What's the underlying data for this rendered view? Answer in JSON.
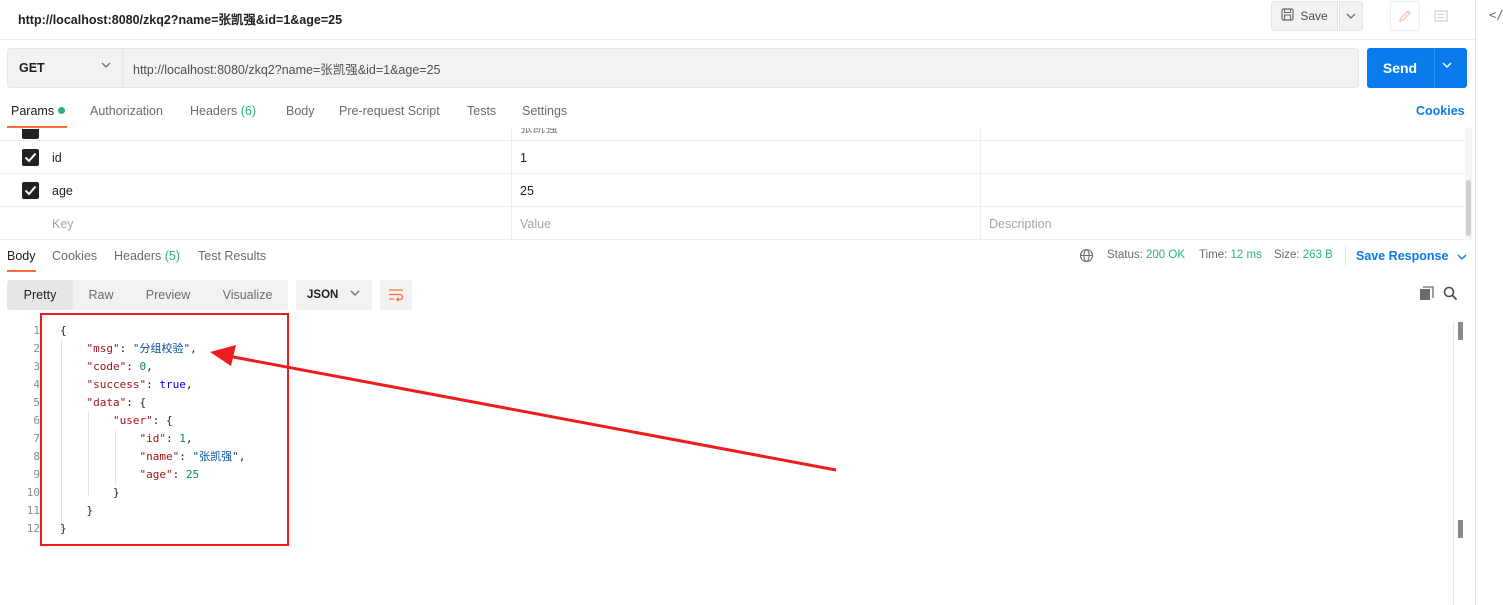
{
  "request": {
    "title": "http://localhost:8080/zkq2?name=张凯强&id=1&age=25",
    "save_label": "Save",
    "method": "GET",
    "url": "http://localhost:8080/zkq2?name=张凯强&id=1&age=25",
    "send_label": "Send"
  },
  "request_tabs": {
    "params": "Params",
    "authorization": "Authorization",
    "headers": "Headers",
    "headers_count": "(6)",
    "body": "Body",
    "prerequest": "Pre-request Script",
    "tests": "Tests",
    "settings": "Settings",
    "cookies": "Cookies"
  },
  "params": {
    "partial_value": "张凯强",
    "rows": [
      {
        "key": "id",
        "value": "1",
        "checked": true
      },
      {
        "key": "age",
        "value": "25",
        "checked": true
      }
    ],
    "placeholder_key": "Key",
    "placeholder_value": "Value",
    "placeholder_description": "Description"
  },
  "response_tabs": {
    "body": "Body",
    "cookies": "Cookies",
    "headers": "Headers",
    "headers_count": "(5)",
    "test_results": "Test Results"
  },
  "response_meta": {
    "status_label": "Status:",
    "status_value": "200 OK",
    "time_label": "Time:",
    "time_value": "12 ms",
    "size_label": "Size:",
    "size_value": "263 B",
    "save_response": "Save Response"
  },
  "body_view": {
    "pretty": "Pretty",
    "raw": "Raw",
    "preview": "Preview",
    "visualize": "Visualize",
    "format": "JSON"
  },
  "json_lines": [
    {
      "n": "1",
      "parts": [
        [
          "p",
          "{"
        ]
      ]
    },
    {
      "n": "2",
      "parts": [
        [
          "k",
          "    \"msg\""
        ],
        [
          "p",
          ": "
        ],
        [
          "s",
          "\"分组校验\""
        ],
        [
          "p",
          ","
        ]
      ]
    },
    {
      "n": "3",
      "parts": [
        [
          "k",
          "    \"code\""
        ],
        [
          "p",
          ": "
        ],
        [
          "n",
          "0"
        ],
        [
          "p",
          ","
        ]
      ]
    },
    {
      "n": "4",
      "parts": [
        [
          "k",
          "    \"success\""
        ],
        [
          "p",
          ": "
        ],
        [
          "b",
          "true"
        ],
        [
          "p",
          ","
        ]
      ]
    },
    {
      "n": "5",
      "parts": [
        [
          "k",
          "    \"data\""
        ],
        [
          "p",
          ": {"
        ]
      ]
    },
    {
      "n": "6",
      "parts": [
        [
          "k",
          "        \"user\""
        ],
        [
          "p",
          ": {"
        ]
      ]
    },
    {
      "n": "7",
      "parts": [
        [
          "k",
          "            \"id\""
        ],
        [
          "p",
          ": "
        ],
        [
          "n",
          "1"
        ],
        [
          "p",
          ","
        ]
      ]
    },
    {
      "n": "8",
      "parts": [
        [
          "k",
          "            \"name\""
        ],
        [
          "p",
          ": "
        ],
        [
          "s",
          "\"张凯强\""
        ],
        [
          "p",
          ","
        ]
      ]
    },
    {
      "n": "9",
      "parts": [
        [
          "k",
          "            \"age\""
        ],
        [
          "p",
          ": "
        ],
        [
          "n",
          "25"
        ]
      ]
    },
    {
      "n": "10",
      "parts": [
        [
          "p",
          "        }"
        ]
      ]
    },
    {
      "n": "11",
      "parts": [
        [
          "p",
          "    }"
        ]
      ]
    },
    {
      "n": "12",
      "parts": [
        [
          "p",
          "}"
        ]
      ]
    }
  ],
  "colors": {
    "accent": "#ff6c37",
    "send": "#097bed",
    "success": "#26b47f",
    "annotation": "#ee1c1c"
  }
}
